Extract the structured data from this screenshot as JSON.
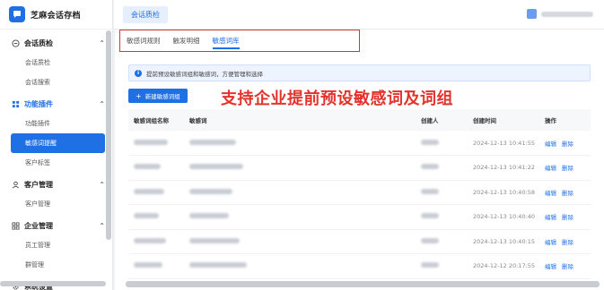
{
  "brand": {
    "name": "芝麻会话存档"
  },
  "sidebar": {
    "groups": [
      {
        "label": "会话质检",
        "icon": "minus-circle-icon",
        "items": [
          "会话质检",
          "会话搜索"
        ]
      },
      {
        "label": "功能插件",
        "icon": "grid-icon",
        "items": [
          "功能插件",
          "敏感词提醒",
          "客户标签"
        ]
      },
      {
        "label": "客户管理",
        "icon": "user-icon",
        "items": [
          "客户管理"
        ]
      },
      {
        "label": "企业管理",
        "icon": "grid-icon",
        "items": [
          "员工管理",
          "群管理"
        ]
      },
      {
        "label": "系统设置",
        "icon": "gear-icon",
        "items": []
      }
    ],
    "active_item": "敏感词提醒"
  },
  "header": {
    "breadcrumb": "会话质检"
  },
  "tabs": [
    {
      "label": "敏感词规则",
      "active": false
    },
    {
      "label": "触发明细",
      "active": false
    },
    {
      "label": "敏感词库",
      "active": true
    }
  ],
  "notice": "提前预设敏感词组和敏感词，方便管理和选择",
  "add_button": "新建敏感词组",
  "promo_text": "支持企业提前预设敏感词及词组",
  "table": {
    "headers": [
      "敏感词组名称",
      "敏感词",
      "创建人",
      "创建时间",
      "操作"
    ],
    "rows": [
      {
        "time": "2024-12-13 10:41:55"
      },
      {
        "time": "2024-12-13 10:41:22"
      },
      {
        "time": "2024-12-13 10:40:58"
      },
      {
        "time": "2024-12-13 10:40:40"
      },
      {
        "time": "2024-12-13 10:40:15"
      },
      {
        "time": "2024-12-12 20:17:55"
      }
    ],
    "actions": {
      "edit": "编辑",
      "delete": "删除"
    }
  },
  "colors": {
    "primary": "#1f6fe5",
    "highlight": "#d43a2c",
    "promo": "#e2342c"
  }
}
